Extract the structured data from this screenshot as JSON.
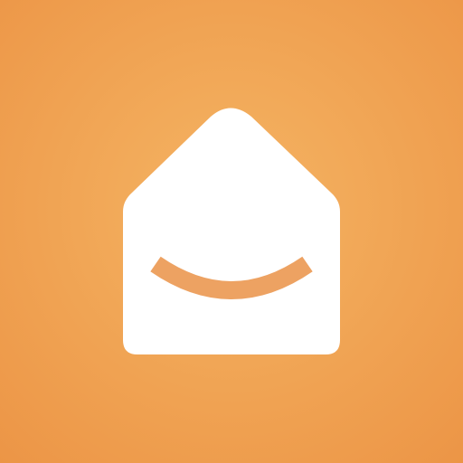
{
  "app_icon": {
    "icon_name": "house-smile-icon",
    "colors": {
      "background_center": "#f5b463",
      "background_edge": "#ec9546",
      "house_fill": "#ffffff",
      "smile_stroke": "#eda262"
    }
  }
}
